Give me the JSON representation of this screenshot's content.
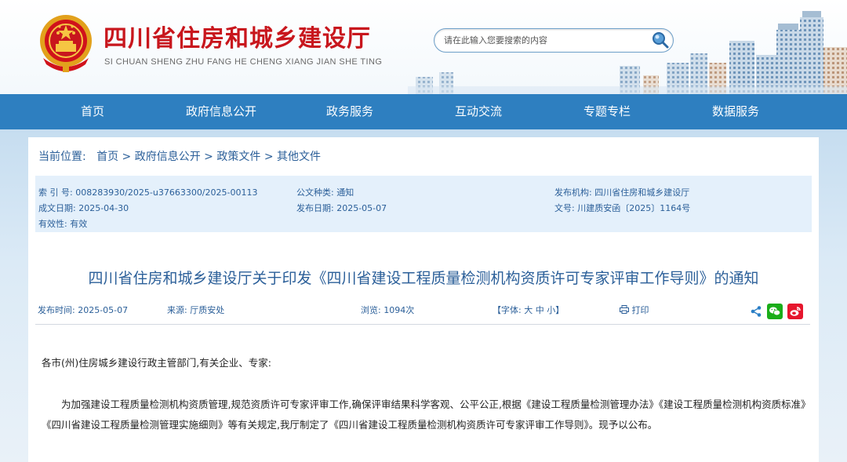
{
  "header": {
    "site_title": "四川省住房和城乡建设厅",
    "site_pinyin": "SI CHUAN SHENG ZHU FANG HE CHENG XIANG JIAN SHE TING",
    "search_placeholder": "请在此输入您要搜索的内容",
    "search_icon": "magnifier-icon",
    "emblem": "national-emblem"
  },
  "nav": {
    "items": [
      "首页",
      "政府信息公开",
      "政务服务",
      "互动交流",
      "专题专栏",
      "数据服务"
    ]
  },
  "breadcrumb": {
    "label": "当前位置:",
    "items": [
      "首页",
      "政府信息公开",
      "政策文件",
      "其他文件"
    ],
    "separator": ">"
  },
  "meta": {
    "index_no": "索 引 号: 008283930/2025-u37663300/2025-00113",
    "doc_type": "公文种类: 通知",
    "issuer": "发布机构: 四川省住房和城乡建设厅",
    "created_date": "成文日期: 2025-04-30",
    "publish_date": "发布日期: 2025-05-07",
    "doc_no": "文号: 川建质安函〔2025〕1164号",
    "validity": "有效性: 有效"
  },
  "article": {
    "title": "四川省住房和城乡建设厅关于印发《四川省建设工程质量检测机构资质许可专家评审工作导则》的通知",
    "publish_time": "发布时间: 2025-05-07",
    "source": "来源: 厅质安处",
    "views": "浏览: 1094次",
    "font_size_label": "【字体: 大 中 小】",
    "print_label": "打印",
    "share_icons": [
      "share-icon",
      "wechat-icon",
      "weibo-icon"
    ],
    "paragraphs": [
      "各市(州)住房城乡建设行政主管部门,有关企业、专家:",
      "为加强建设工程质量检测机构资质管理,规范资质许可专家评审工作,确保评审结果科学客观、公平公正,根据《建设工程质量检测管理办法》《建设工程质量检测机构资质标准》《四川省建设工程质量检测管理实施细则》等有关规定,我厅制定了《四川省建设工程质量检测机构资质许可专家评审工作导则》。现予以公布。"
    ]
  },
  "colors": {
    "brand_red": "#c8161d",
    "nav_blue": "#2e7fc0",
    "link_blue": "#2b5f99",
    "meta_bg": "#e4f0fb"
  }
}
